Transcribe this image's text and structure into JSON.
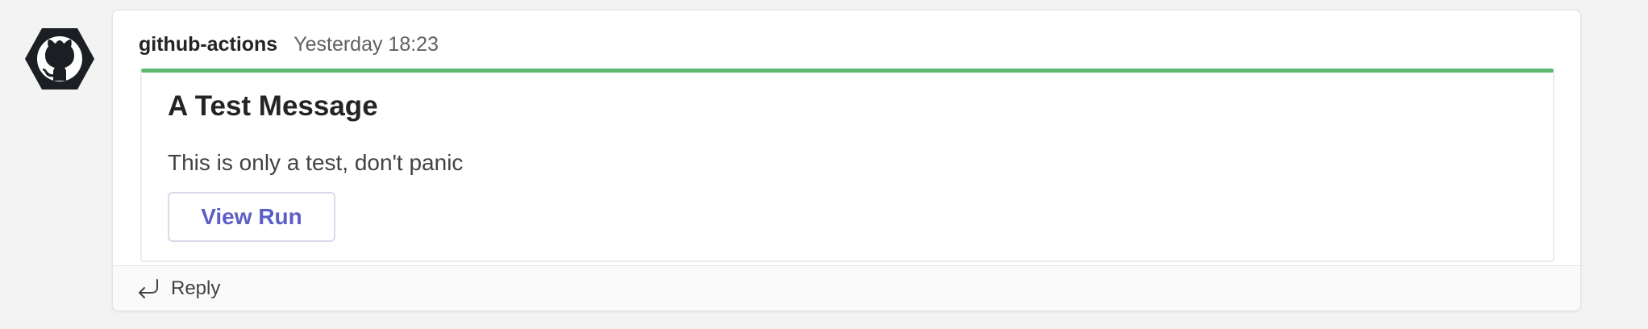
{
  "message": {
    "avatar_icon": "github-octocat-icon",
    "sender": "github-actions",
    "timestamp": "Yesterday 18:23",
    "card": {
      "accent_color": "#5eb870",
      "title": "A Test Message",
      "text": "This is only a test, don't panic",
      "action_label": "View Run",
      "action_color": "#5b5fc7"
    },
    "reply": {
      "icon": "reply-arrow-icon",
      "label": "Reply"
    }
  }
}
